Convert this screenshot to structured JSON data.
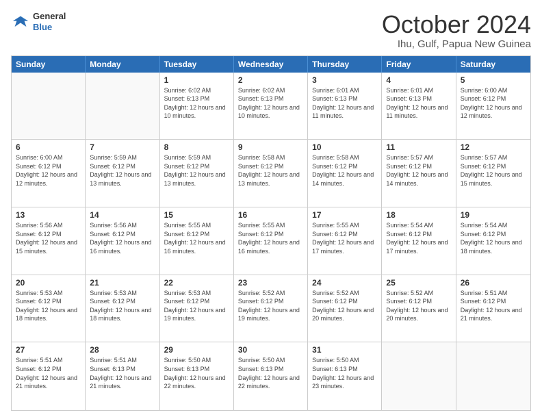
{
  "header": {
    "logo_general": "General",
    "logo_blue": "Blue",
    "month_title": "October 2024",
    "location": "Ihu, Gulf, Papua New Guinea"
  },
  "calendar": {
    "day_names": [
      "Sunday",
      "Monday",
      "Tuesday",
      "Wednesday",
      "Thursday",
      "Friday",
      "Saturday"
    ],
    "weeks": [
      [
        {
          "day": "",
          "empty": true
        },
        {
          "day": "",
          "empty": true
        },
        {
          "day": "1",
          "sunrise": "6:02 AM",
          "sunset": "6:13 PM",
          "daylight": "12 hours and 10 minutes."
        },
        {
          "day": "2",
          "sunrise": "6:02 AM",
          "sunset": "6:13 PM",
          "daylight": "12 hours and 10 minutes."
        },
        {
          "day": "3",
          "sunrise": "6:01 AM",
          "sunset": "6:13 PM",
          "daylight": "12 hours and 11 minutes."
        },
        {
          "day": "4",
          "sunrise": "6:01 AM",
          "sunset": "6:13 PM",
          "daylight": "12 hours and 11 minutes."
        },
        {
          "day": "5",
          "sunrise": "6:00 AM",
          "sunset": "6:12 PM",
          "daylight": "12 hours and 12 minutes."
        }
      ],
      [
        {
          "day": "6",
          "sunrise": "6:00 AM",
          "sunset": "6:12 PM",
          "daylight": "12 hours and 12 minutes."
        },
        {
          "day": "7",
          "sunrise": "5:59 AM",
          "sunset": "6:12 PM",
          "daylight": "12 hours and 13 minutes."
        },
        {
          "day": "8",
          "sunrise": "5:59 AM",
          "sunset": "6:12 PM",
          "daylight": "12 hours and 13 minutes."
        },
        {
          "day": "9",
          "sunrise": "5:58 AM",
          "sunset": "6:12 PM",
          "daylight": "12 hours and 13 minutes."
        },
        {
          "day": "10",
          "sunrise": "5:58 AM",
          "sunset": "6:12 PM",
          "daylight": "12 hours and 14 minutes."
        },
        {
          "day": "11",
          "sunrise": "5:57 AM",
          "sunset": "6:12 PM",
          "daylight": "12 hours and 14 minutes."
        },
        {
          "day": "12",
          "sunrise": "5:57 AM",
          "sunset": "6:12 PM",
          "daylight": "12 hours and 15 minutes."
        }
      ],
      [
        {
          "day": "13",
          "sunrise": "5:56 AM",
          "sunset": "6:12 PM",
          "daylight": "12 hours and 15 minutes."
        },
        {
          "day": "14",
          "sunrise": "5:56 AM",
          "sunset": "6:12 PM",
          "daylight": "12 hours and 16 minutes."
        },
        {
          "day": "15",
          "sunrise": "5:55 AM",
          "sunset": "6:12 PM",
          "daylight": "12 hours and 16 minutes."
        },
        {
          "day": "16",
          "sunrise": "5:55 AM",
          "sunset": "6:12 PM",
          "daylight": "12 hours and 16 minutes."
        },
        {
          "day": "17",
          "sunrise": "5:55 AM",
          "sunset": "6:12 PM",
          "daylight": "12 hours and 17 minutes."
        },
        {
          "day": "18",
          "sunrise": "5:54 AM",
          "sunset": "6:12 PM",
          "daylight": "12 hours and 17 minutes."
        },
        {
          "day": "19",
          "sunrise": "5:54 AM",
          "sunset": "6:12 PM",
          "daylight": "12 hours and 18 minutes."
        }
      ],
      [
        {
          "day": "20",
          "sunrise": "5:53 AM",
          "sunset": "6:12 PM",
          "daylight": "12 hours and 18 minutes."
        },
        {
          "day": "21",
          "sunrise": "5:53 AM",
          "sunset": "6:12 PM",
          "daylight": "12 hours and 18 minutes."
        },
        {
          "day": "22",
          "sunrise": "5:53 AM",
          "sunset": "6:12 PM",
          "daylight": "12 hours and 19 minutes."
        },
        {
          "day": "23",
          "sunrise": "5:52 AM",
          "sunset": "6:12 PM",
          "daylight": "12 hours and 19 minutes."
        },
        {
          "day": "24",
          "sunrise": "5:52 AM",
          "sunset": "6:12 PM",
          "daylight": "12 hours and 20 minutes."
        },
        {
          "day": "25",
          "sunrise": "5:52 AM",
          "sunset": "6:12 PM",
          "daylight": "12 hours and 20 minutes."
        },
        {
          "day": "26",
          "sunrise": "5:51 AM",
          "sunset": "6:12 PM",
          "daylight": "12 hours and 21 minutes."
        }
      ],
      [
        {
          "day": "27",
          "sunrise": "5:51 AM",
          "sunset": "6:12 PM",
          "daylight": "12 hours and 21 minutes."
        },
        {
          "day": "28",
          "sunrise": "5:51 AM",
          "sunset": "6:13 PM",
          "daylight": "12 hours and 21 minutes."
        },
        {
          "day": "29",
          "sunrise": "5:50 AM",
          "sunset": "6:13 PM",
          "daylight": "12 hours and 22 minutes."
        },
        {
          "day": "30",
          "sunrise": "5:50 AM",
          "sunset": "6:13 PM",
          "daylight": "12 hours and 22 minutes."
        },
        {
          "day": "31",
          "sunrise": "5:50 AM",
          "sunset": "6:13 PM",
          "daylight": "12 hours and 23 minutes."
        },
        {
          "day": "",
          "empty": true
        },
        {
          "day": "",
          "empty": true
        }
      ]
    ]
  }
}
